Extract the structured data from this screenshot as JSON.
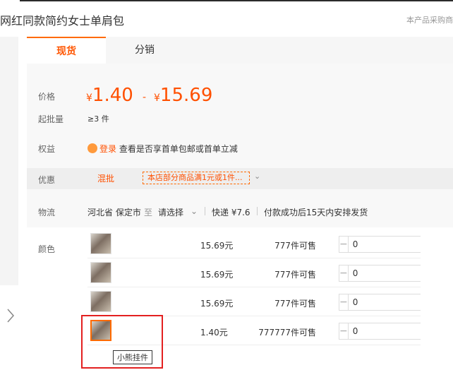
{
  "header": {
    "title": "网红同款简约女士单肩包",
    "notice": "本产品采购商"
  },
  "tabs": [
    {
      "label": "现货",
      "active": true
    },
    {
      "label": "分销",
      "active": false
    }
  ],
  "price": {
    "label": "价格",
    "currency": "¥",
    "low": "1.40",
    "dash": "-",
    "high": "15.69"
  },
  "moq": {
    "label": "起批量",
    "value": "≥3 件"
  },
  "benefits": {
    "label": "权益",
    "login": "登录",
    "text": "查看是否享首单包邮或首单立减"
  },
  "promo": {
    "label": "优惠",
    "tag": "混批",
    "desc": "本店部分商品满1元或1件...",
    "caret": "⌄"
  },
  "logistics": {
    "label": "物流",
    "origin": "河北省 保定市",
    "to": "至",
    "destination": "请选择",
    "caret": "⌄",
    "express": "快递 ¥7.6",
    "ship": "付款成功后15天内安排发货"
  },
  "sku": {
    "label": "颜色",
    "rows": [
      {
        "price": "15.69元",
        "stock": "777件可售",
        "qty": "0",
        "selected": false
      },
      {
        "price": "15.69元",
        "stock": "777件可售",
        "qty": "0",
        "selected": false
      },
      {
        "price": "15.69元",
        "stock": "777件可售",
        "qty": "0",
        "selected": false
      },
      {
        "price": "1.40元",
        "stock": "777777件可售",
        "qty": "0",
        "selected": true
      }
    ],
    "tooltip": "小熊挂件"
  },
  "colors": {
    "accent": "#ff5000",
    "tab_border": "#ff6a00",
    "highlight": "#e32020"
  }
}
